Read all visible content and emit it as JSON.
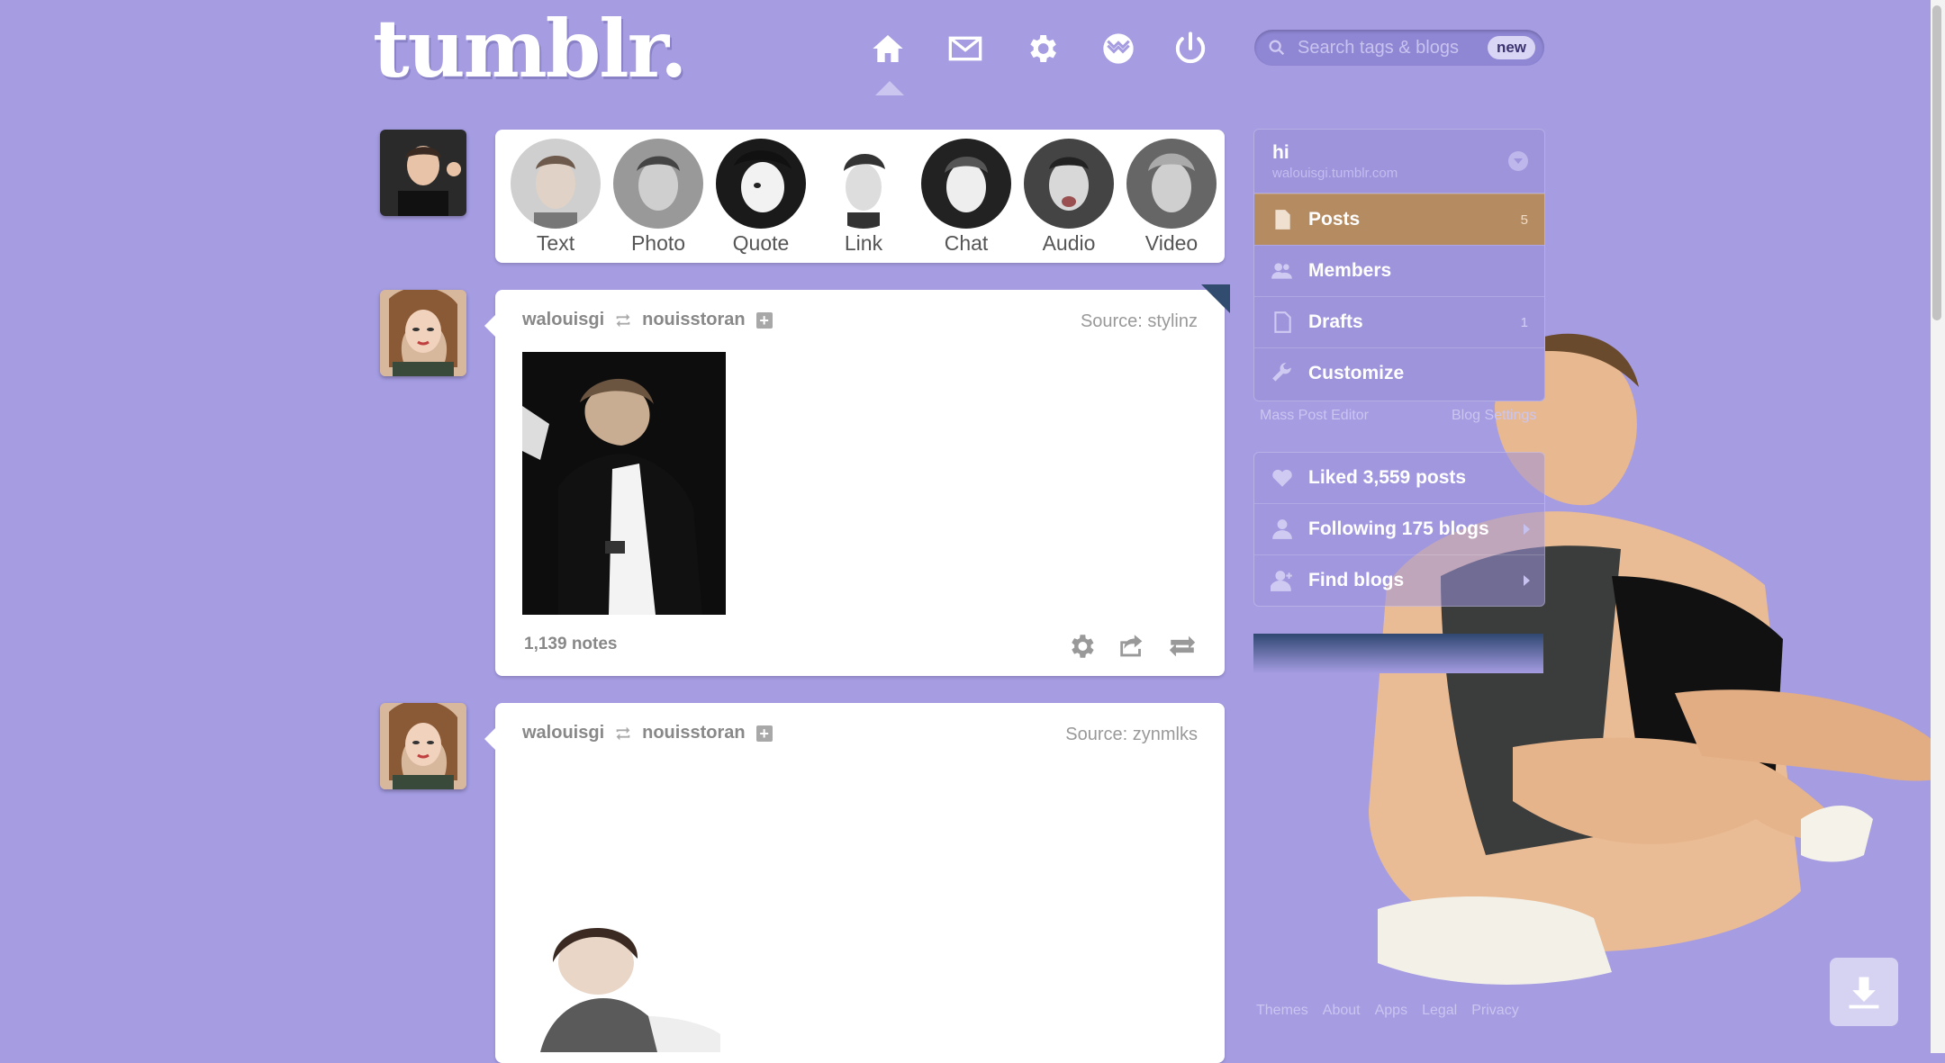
{
  "header": {
    "logo": "tumblr.",
    "search_placeholder": "Search tags & blogs",
    "search_badge": "new",
    "nav_icons": [
      "home-icon",
      "mail-icon",
      "gear-icon",
      "activity-icon",
      "power-icon"
    ]
  },
  "post_types": [
    {
      "label": "Text"
    },
    {
      "label": "Photo"
    },
    {
      "label": "Quote"
    },
    {
      "label": "Link"
    },
    {
      "label": "Chat"
    },
    {
      "label": "Audio"
    },
    {
      "label": "Video"
    }
  ],
  "posts": [
    {
      "author": "walouisgi",
      "reblogged_from": "nouisstoran",
      "source": "Source: stylinz",
      "notes": "1,139 notes"
    },
    {
      "author": "walouisgi",
      "reblogged_from": "nouisstoran",
      "source": "Source: zynmlks"
    }
  ],
  "sidebar": {
    "blog_name": "hi",
    "blog_url": "walouisgi.tumblr.com",
    "items": [
      {
        "label": "Posts",
        "count": "5"
      },
      {
        "label": "Members"
      },
      {
        "label": "Drafts",
        "count": "1"
      },
      {
        "label": "Customize"
      }
    ],
    "mass_post_editor": "Mass Post Editor",
    "blog_settings": "Blog Settings",
    "stats": [
      {
        "label": "Liked 3,559 posts"
      },
      {
        "label": "Following 175 blogs"
      },
      {
        "label": "Find blogs"
      }
    ]
  },
  "footer": [
    "Themes",
    "About",
    "Apps",
    "Legal",
    "Privacy"
  ],
  "colors": {
    "background": "#a59ce2",
    "active_item": "#b58b62",
    "accent_dark": "#324c70"
  }
}
